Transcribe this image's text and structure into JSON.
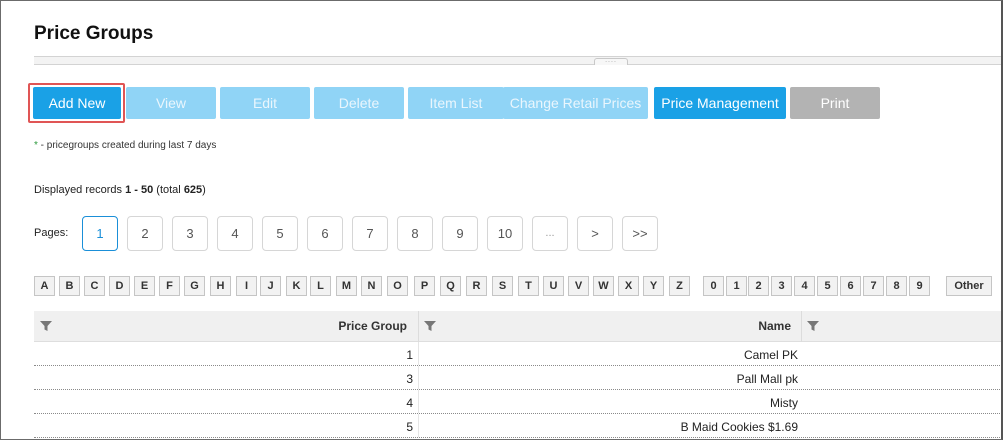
{
  "page": {
    "title": "Price Groups"
  },
  "toolbar": {
    "buttons": [
      {
        "label": "Add New",
        "state": "primary"
      },
      {
        "label": "View",
        "state": "disabled"
      },
      {
        "label": "Edit",
        "state": "disabled"
      },
      {
        "label": "Delete",
        "state": "disabled"
      },
      {
        "label": "Item List",
        "state": "disabled"
      },
      {
        "label": "Change Retail Prices",
        "state": "disabled"
      },
      {
        "label": "Price Management",
        "state": "primary"
      },
      {
        "label": "Print",
        "state": "gray"
      }
    ]
  },
  "note": {
    "star": "*",
    "text": " - pricegroups created during last 7 days"
  },
  "records": {
    "prefix": "Displayed records ",
    "range": "1 - 50",
    "mid": " (total ",
    "total": "625",
    "suffix": ")"
  },
  "pagination": {
    "label": "Pages:",
    "pages": [
      "1",
      "2",
      "3",
      "4",
      "5",
      "6",
      "7",
      "8",
      "9",
      "10",
      "...",
      ">",
      ">>"
    ],
    "active": "1"
  },
  "alphabet": [
    "A",
    "B",
    "C",
    "D",
    "E",
    "F",
    "G",
    "H",
    "I",
    "J",
    "K",
    "L",
    "M",
    "N",
    "O",
    "P",
    "Q",
    "R",
    "S",
    "T",
    "U",
    "V",
    "W",
    "X",
    "Y",
    "Z",
    "0",
    "1",
    "2",
    "3",
    "4",
    "5",
    "6",
    "7",
    "8",
    "9",
    "Other"
  ],
  "grid": {
    "columns": [
      "Price Group",
      "Name"
    ],
    "rows": [
      {
        "price_group": "1",
        "name": "Camel PK"
      },
      {
        "price_group": "3",
        "name": "Pall Mall pk"
      },
      {
        "price_group": "4",
        "name": "Misty"
      },
      {
        "price_group": "5",
        "name": "B Maid Cookies $1.69"
      }
    ]
  },
  "colors": {
    "primary": "#1aa1e6",
    "disabled": "#90d4f6",
    "gray": "#b3b3b3",
    "highlight": "#e05555",
    "active_page": "#1a8fd8"
  }
}
